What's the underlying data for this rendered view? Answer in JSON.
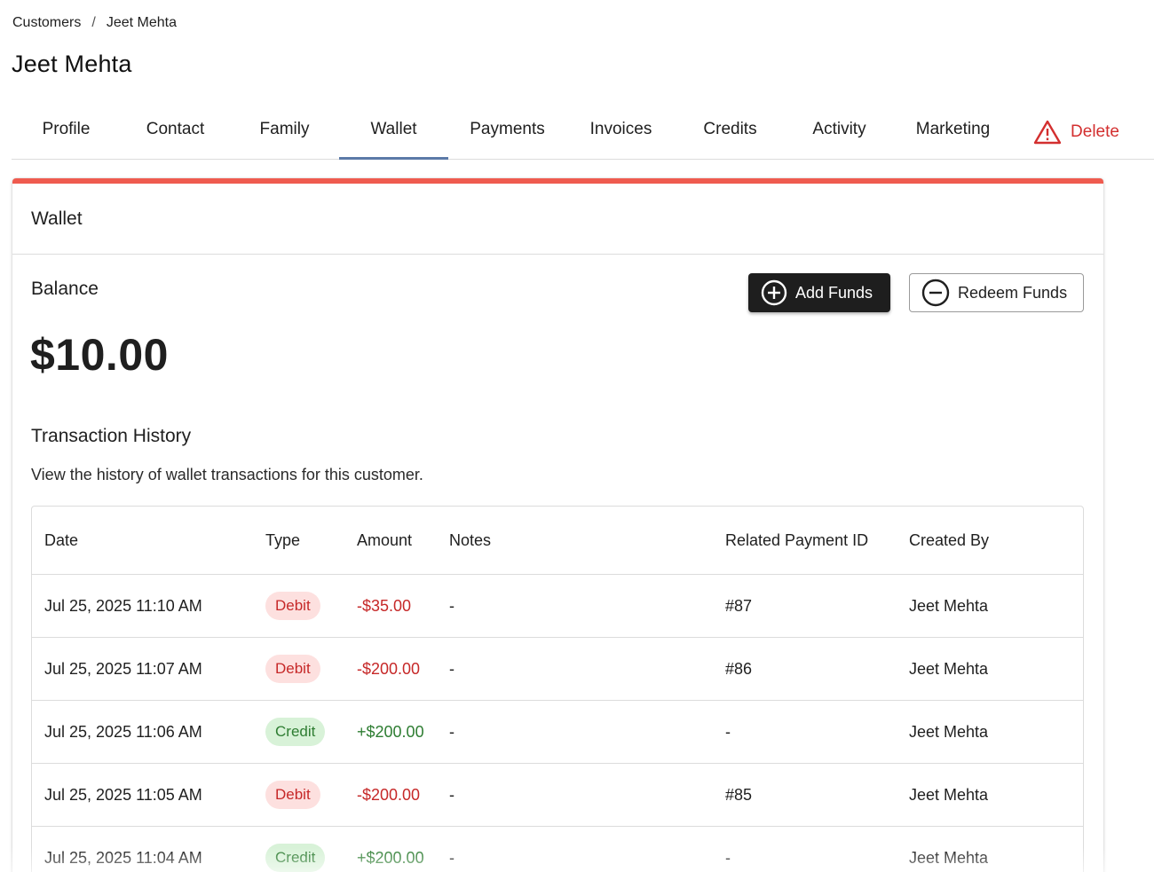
{
  "breadcrumb": {
    "parent": "Customers",
    "separator": "/",
    "current": "Jeet Mehta"
  },
  "page": {
    "title": "Jeet Mehta"
  },
  "tabs": [
    {
      "label": "Profile"
    },
    {
      "label": "Contact"
    },
    {
      "label": "Family"
    },
    {
      "label": "Wallet",
      "active": true
    },
    {
      "label": "Payments"
    },
    {
      "label": "Invoices"
    },
    {
      "label": "Credits"
    },
    {
      "label": "Activity"
    },
    {
      "label": "Marketing"
    }
  ],
  "delete_tab": {
    "label": "Delete",
    "icon": "warning-icon",
    "color": "#d32f2f"
  },
  "wallet": {
    "header_title": "Wallet",
    "accent_color": "#ef5b4f",
    "balance_label": "Balance",
    "balance_amount": "$10.00",
    "add_funds_label": "Add Funds",
    "add_funds_icon": "plus-circle-icon",
    "redeem_funds_label": "Redeem Funds",
    "redeem_funds_icon": "minus-circle-icon"
  },
  "history": {
    "title": "Transaction History",
    "description": "View the history of wallet transactions for this customer.",
    "columns": [
      "Date",
      "Type",
      "Amount",
      "Notes",
      "Related Payment ID",
      "Created By"
    ],
    "rows": [
      {
        "date": "Jul 25, 2025 11:10 AM",
        "type": "Debit",
        "amount": "-$35.00",
        "notes": "-",
        "related": "#87",
        "created_by": "Jeet Mehta"
      },
      {
        "date": "Jul 25, 2025 11:07 AM",
        "type": "Debit",
        "amount": "-$200.00",
        "notes": "-",
        "related": "#86",
        "created_by": "Jeet Mehta"
      },
      {
        "date": "Jul 25, 2025 11:06 AM",
        "type": "Credit",
        "amount": "+$200.00",
        "notes": "-",
        "related": "-",
        "created_by": "Jeet Mehta"
      },
      {
        "date": "Jul 25, 2025 11:05 AM",
        "type": "Debit",
        "amount": "-$200.00",
        "notes": "-",
        "related": "#85",
        "created_by": "Jeet Mehta"
      },
      {
        "date": "Jul 25, 2025 11:04 AM",
        "type": "Credit",
        "amount": "+$200.00",
        "notes": "-",
        "related": "-",
        "created_by": "Jeet Mehta"
      }
    ]
  },
  "colors": {
    "debit": "#c62828",
    "credit": "#2e7d32",
    "tab_indicator": "#5c7aa8"
  }
}
